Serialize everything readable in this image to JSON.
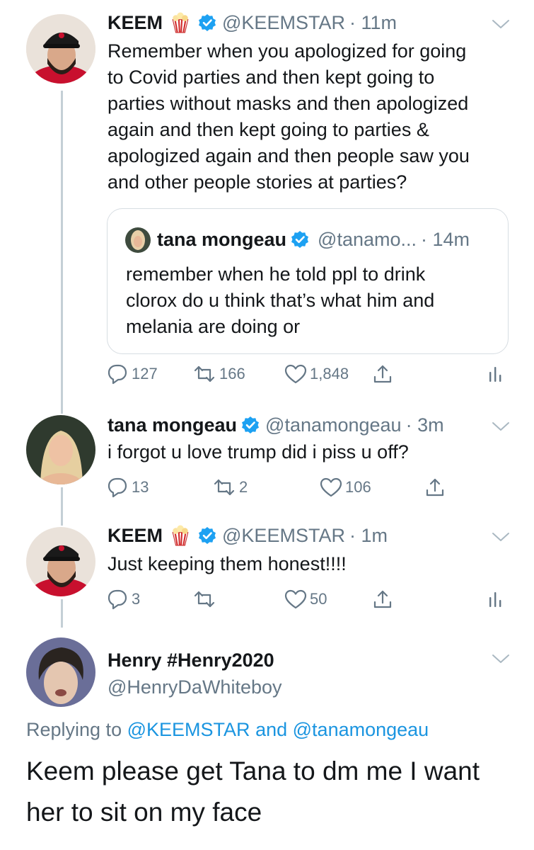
{
  "tweet1": {
    "name": "KEEM",
    "emoji": "🍿",
    "handle": "@KEEMSTAR",
    "time": "· 11m",
    "lines": [
      "Remember when you apologized for going",
      "to Covid parties and then kept going to",
      "parties without masks and then apologized",
      "again and then kept going to parties &",
      "apologized again and then people saw you",
      "and other people stories at parties?"
    ],
    "quote": {
      "name": "tana mongeau",
      "handle": "@tanamo...",
      "time": "· 14m",
      "lines": [
        "remember when he told ppl to drink",
        "clorox do u think that’s what him and",
        "melania are doing or"
      ]
    },
    "replies": "127",
    "retweets": "166",
    "likes": "1,848"
  },
  "tweet2": {
    "name": "tana mongeau",
    "handle": "@tanamongeau",
    "time": "· 3m",
    "text": "i forgot u love trump did i piss u off?",
    "replies": "13",
    "retweets": "2",
    "likes": "106"
  },
  "tweet3": {
    "name": "KEEM",
    "emoji": "🍿",
    "handle": "@KEEMSTAR",
    "time": "· 1m",
    "text": "Just keeping them honest!!!!",
    "replies": "3",
    "retweets": "",
    "likes": "50"
  },
  "tweet4": {
    "name": "Henry #Henry2020",
    "handle": "@HenryDaWhiteboy",
    "replying_prefix": "Replying to",
    "mention1": "@KEEMSTAR",
    "and": "and",
    "mention2": "@tanamongeau",
    "lines": [
      "Keem please get Tana to dm me I want",
      "her to sit on my face"
    ]
  },
  "icons": {
    "reply": "reply-icon",
    "retweet": "retweet-icon",
    "like": "heart-icon",
    "share": "share-icon",
    "analytics": "analytics-icon",
    "verified": "verified-badge-icon",
    "more": "chevron-down-icon"
  },
  "colors": {
    "text": "#14171a",
    "secondary": "#657786",
    "link": "#1b95e0",
    "verified": "#1da1f2",
    "thread": "#c4cfd6"
  }
}
